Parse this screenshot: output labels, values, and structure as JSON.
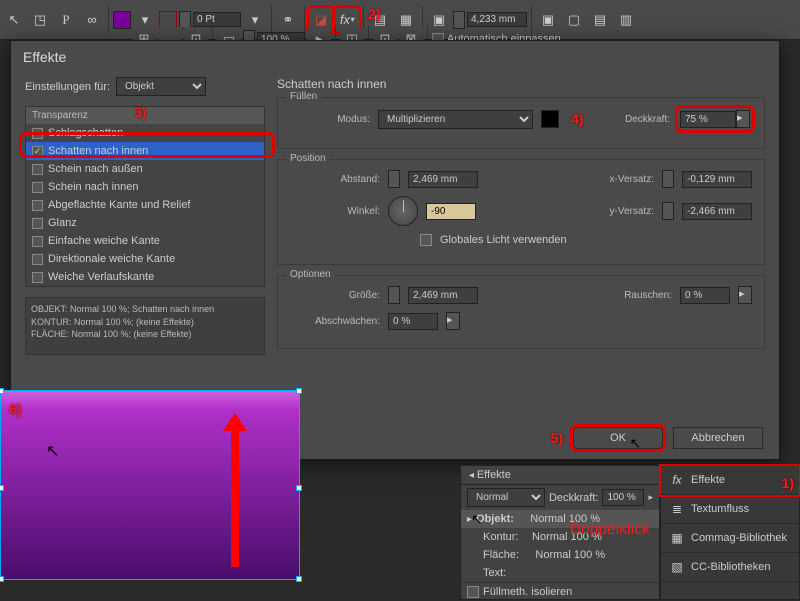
{
  "toolbar": {
    "stroke": "0 Pt",
    "measure": "4,233 mm",
    "zoom": "100 %",
    "autofit": "Automatisch einpassen"
  },
  "dialog": {
    "title": "Effekte",
    "settings_for_label": "Einstellungen für:",
    "settings_for_value": "Objekt",
    "section_title": "Schatten nach innen",
    "effects_header": "Transparenz",
    "effects": [
      {
        "label": "Schlagschatten",
        "checked": false
      },
      {
        "label": "Schatten nach innen",
        "checked": true,
        "active": true
      },
      {
        "label": "Schein nach außen",
        "checked": false
      },
      {
        "label": "Schein nach innen",
        "checked": false
      },
      {
        "label": "Abgeflachte Kante und Relief",
        "checked": false
      },
      {
        "label": "Glanz",
        "checked": false
      },
      {
        "label": "Einfache weiche Kante",
        "checked": false
      },
      {
        "label": "Direktionale weiche Kante",
        "checked": false
      },
      {
        "label": "Weiche Verlaufskante",
        "checked": false
      }
    ],
    "summary": "OBJEKT: Normal 100 %; Schatten nach innen\nKONTUR: Normal 100 %; (keine Effekte)\nFLÄCHE: Normal 100 %; (keine Effekte)",
    "fill": {
      "legend": "Füllen",
      "mode_label": "Modus:",
      "mode_value": "Multiplizieren",
      "opacity_label": "Deckkraft:",
      "opacity_value": "75 %"
    },
    "position": {
      "legend": "Position",
      "distance_label": "Abstand:",
      "distance_value": "2,469 mm",
      "angle_label": "Winkel:",
      "angle_value": "-90",
      "global_light": "Globales Licht verwenden",
      "xoff_label": "x-Versatz:",
      "xoff_value": "-0,129 mm",
      "yoff_label": "y-Versatz:",
      "yoff_value": "-2,466 mm"
    },
    "options": {
      "legend": "Optionen",
      "size_label": "Größe:",
      "size_value": "2,469 mm",
      "choke_label": "Abschwächen:",
      "choke_value": "0 %",
      "noise_label": "Rauschen:",
      "noise_value": "0 %"
    },
    "ok": "OK",
    "cancel": "Abbrechen"
  },
  "panels": {
    "effects_tab": "Effekte",
    "normal": "Normal",
    "opacity_label": "Deckkraft:",
    "opacity_value": "100 %",
    "obj": "Objekt:",
    "obj_val": "Normal 100 %",
    "stroke": "Kontur:",
    "stroke_val": "Normal 100 %",
    "fill": "Fläche:",
    "fill_val": "Normal 100 %",
    "text": "Text:",
    "isolate": "Füllmeth. isolieren",
    "side": [
      {
        "label": "Effekte",
        "icon": "fx"
      },
      {
        "label": "Textumfluss",
        "icon": "≣"
      },
      {
        "label": "Commag-Bibliothek",
        "icon": "▦"
      },
      {
        "label": "CC-Bibliotheken",
        "icon": "▧"
      }
    ]
  },
  "annotations": {
    "a1": "1)",
    "a2": "2)",
    "a3": "3)",
    "a4": "4)",
    "a5": "5)",
    "a6": "6)",
    "dbl": "Doppelklick"
  }
}
